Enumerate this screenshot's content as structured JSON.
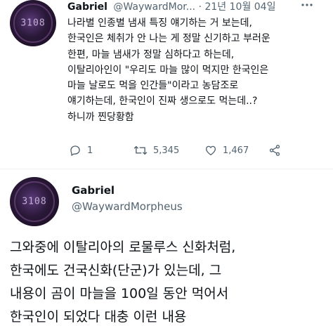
{
  "tweet": {
    "author_name": "Gabriel",
    "author_handle": "@WaywardMor...",
    "separator": "·",
    "date": "21년 10월 04일",
    "avatar_text": "3108",
    "lines": [
      "나라별 인종별 냄새 특징 얘기하는 거 보는데,",
      "한국인은 체취가 안 나는 게 정말 신기하고 부러운",
      "한편, 마늘 냄새가 정말 심하다고 하는데,",
      "이탈리아인이 \"우리도 마늘 많이 먹지만 한국인은",
      "마늘 날로도 먹을 인간들\"이라고 농담조로",
      "얘기하는데, 한국인이 진짜 생으로도 먹는데..?",
      "하니까 찐당황함"
    ],
    "reply_count": "1",
    "retweet_count": "5,345",
    "like_count": "1,467"
  },
  "reply": {
    "author_name": "Gabriel",
    "author_handle": "@WaywardMorpheus",
    "avatar_text": "3108",
    "lines": [
      "그와중에 이탈리아의 로물루스 신화처럼,",
      "한국에도 건국신화(단군)가 있는데, 그",
      "내용이 곰이 마늘을 100일 동안 먹어서",
      "한국인이 되었다 대충 이런 내용"
    ]
  },
  "icons": {
    "reply": "reply-icon",
    "retweet": "retweet-icon",
    "like": "heart-icon",
    "share": "share-icon",
    "more": "more-icon"
  }
}
